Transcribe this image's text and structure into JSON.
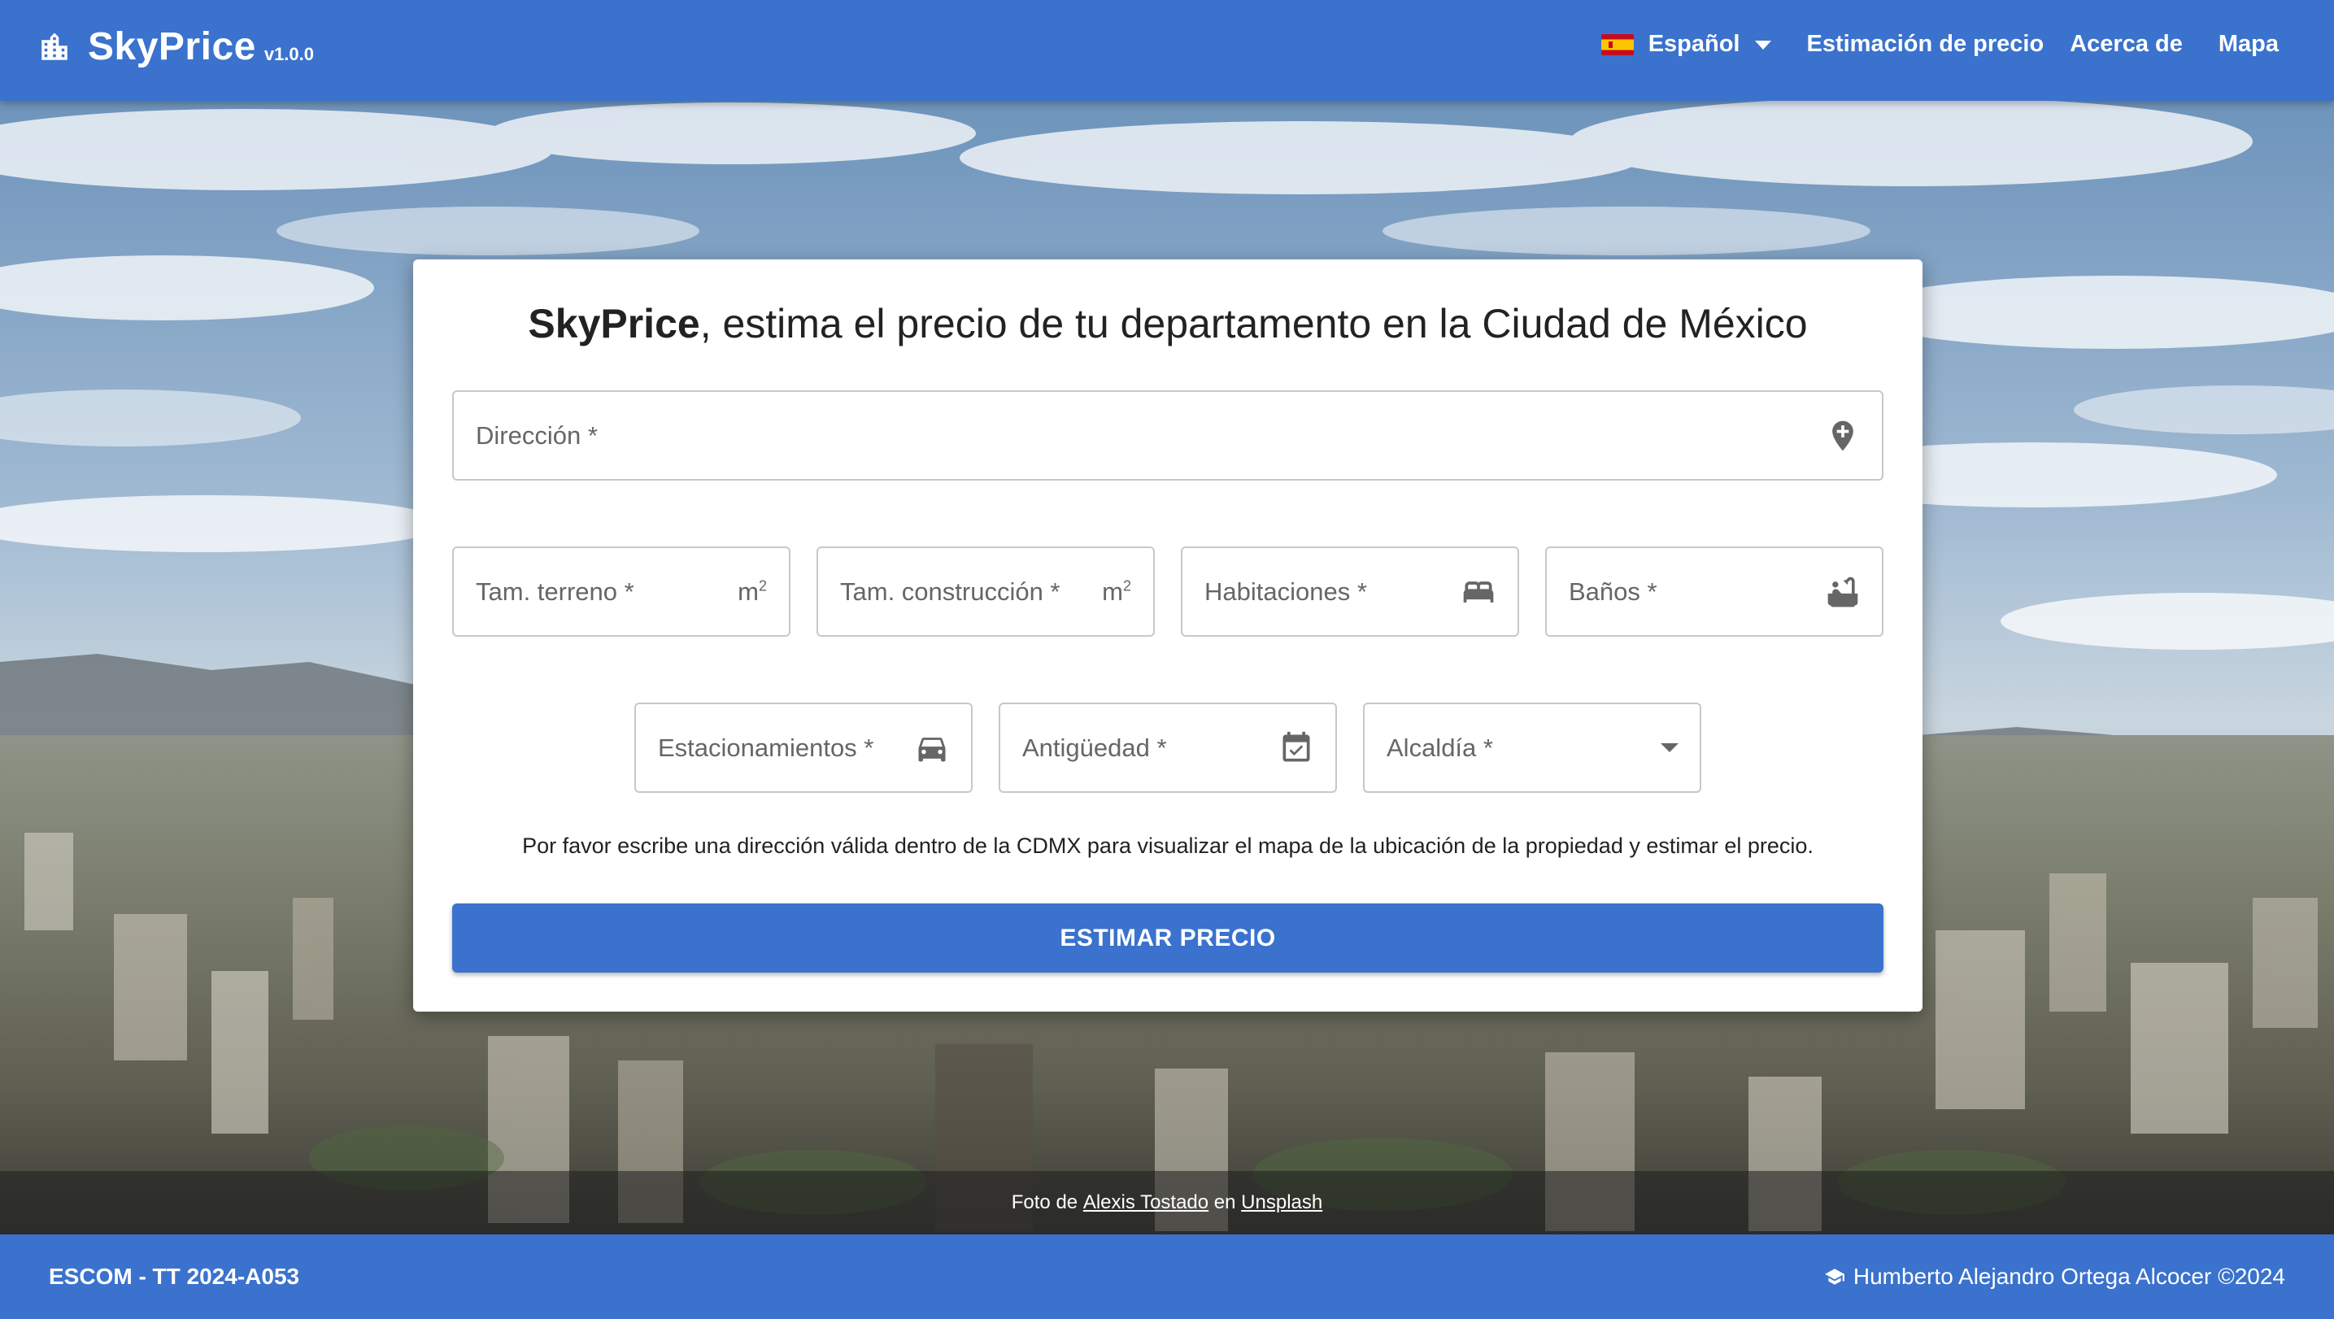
{
  "header": {
    "brand_name": "SkyPrice",
    "brand_version": "v1.0.0",
    "language": "Español",
    "nav": [
      "Estimación de precio",
      "Acerca de",
      "Mapa"
    ]
  },
  "card": {
    "title_strong": "SkyPrice",
    "title_rest": ", estima el precio de tu departamento en la Ciudad de México",
    "fields": {
      "direccion": "Dirección *",
      "terreno": "Tam. terreno *",
      "terreno_unit": "m",
      "terreno_unit_sup": "2",
      "construccion": "Tam. construcción *",
      "construccion_unit": "m",
      "construccion_unit_sup": "2",
      "habitaciones": "Habitaciones *",
      "banos": "Baños *",
      "estacionamientos": "Estacionamientos *",
      "antiguedad": "Antigüedad *",
      "alcaldia": "Alcaldía *"
    },
    "hint": "Por favor escribe una dirección válida dentro de la CDMX para visualizar el mapa de la ubicación de la propiedad y estimar el precio.",
    "button": "ESTIMAR PRECIO"
  },
  "credit": {
    "prefix": "Foto de",
    "author": "Alexis Tostado",
    "middle": "en",
    "site": "Unsplash"
  },
  "footer": {
    "left": "ESCOM - TT 2024-A053",
    "right": "Humberto Alejandro Ortega Alcocer ©2024"
  },
  "icons": {
    "brand": "city-buildings-icon",
    "language": "spain-flag-icon",
    "direccion": "add-location-pin-icon",
    "habitaciones": "bed-icon",
    "banos": "bathtub-icon",
    "estacionamientos": "car-icon",
    "antiguedad": "calendar-check-icon",
    "footer": "graduation-cap-icon"
  },
  "colors": {
    "primary": "#3a72cd",
    "card_bg": "#ffffff",
    "field_border": "#c8c8c8"
  }
}
